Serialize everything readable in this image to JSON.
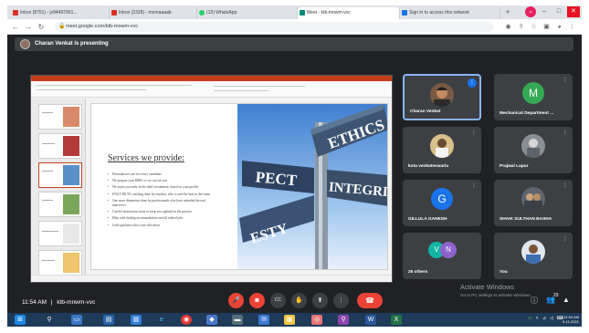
{
  "browser": {
    "tabs": [
      {
        "label": "Inbox (8751) - jv94497961...",
        "color": "#d93025"
      },
      {
        "label": "Inbox (2328) - mnmaaaab",
        "color": "#d93025"
      },
      {
        "label": "(10) WhatsApp",
        "color": "#25d366"
      },
      {
        "label": "Meet - ktb-mnwm-vvc",
        "color": "#00897b"
      },
      {
        "label": "Sign in to access this network",
        "color": "#1a73e8"
      }
    ],
    "new_tab": "+",
    "url": "meet.google.com/ktb-mnwm-vvc",
    "window_controls": {
      "minimize": "–",
      "maximize": "□",
      "close": "✕"
    }
  },
  "meet": {
    "presenting_text": "Charan Venkat is presenting",
    "meeting_time": "11:54 AM",
    "meeting_code": "ktb-mnwm-vvc",
    "separator": "|"
  },
  "slide": {
    "heading": "Services we provide:",
    "bullets": [
      "Personalized care for every candidate",
      "We prepare your RMFs or we can for you",
      "We assist you early in the field recruitment, based on your profile",
      "ENGY IELTS coaching done by teachers, who scored the best in the exam",
      "One more dimension done by professionals who have attended the real interviews",
      "Careful instructions done to keep you updated in the process",
      "Help with finding accommodation and all related jobs",
      "Little guidance after your relocation"
    ],
    "sign_words": [
      "ETHICS",
      "INTEGRIT",
      "PECT",
      "ESTY"
    ],
    "thumb_numbers": [
      "1",
      "2",
      "3",
      "4",
      "5",
      "6"
    ]
  },
  "participants": [
    {
      "name": "Charan Venkat",
      "type": "photo",
      "speaking": true
    },
    {
      "name": "Mechanical Department ...",
      "type": "letter",
      "letter": "M",
      "color": "#34a853"
    },
    {
      "name": "kota venkateswarlu",
      "type": "photo"
    },
    {
      "name": "Prajwal Lapur",
      "type": "photo"
    },
    {
      "name": "GILLULA GANESH",
      "type": "letter",
      "letter": "G",
      "color": "#1a73e8"
    },
    {
      "name": "SHAIK SULTHAN BASHA",
      "type": "photo"
    },
    {
      "name": "25 others",
      "type": "group",
      "letters": [
        "V",
        "N"
      ]
    },
    {
      "name": "You",
      "type": "photo"
    }
  ],
  "controls": {
    "mic": "🎤",
    "camera": "◙",
    "captions": "CC",
    "raise_hand": "✋",
    "present": "⬆",
    "more": "⋮",
    "end_call": "☎"
  },
  "windows": {
    "activate_title": "Activate Windows",
    "activate_sub": "Go to PC settings to activate Windows.",
    "participant_count": "29",
    "clock_time": "11:54 AM",
    "clock_date": "9-11-2021"
  },
  "colors": {
    "meet_bg": "#202124",
    "tile_bg": "#3c4043",
    "end_call": "#ea4335",
    "ppt_accent": "#c43e1c",
    "taskbar": "#1f3b5a"
  }
}
